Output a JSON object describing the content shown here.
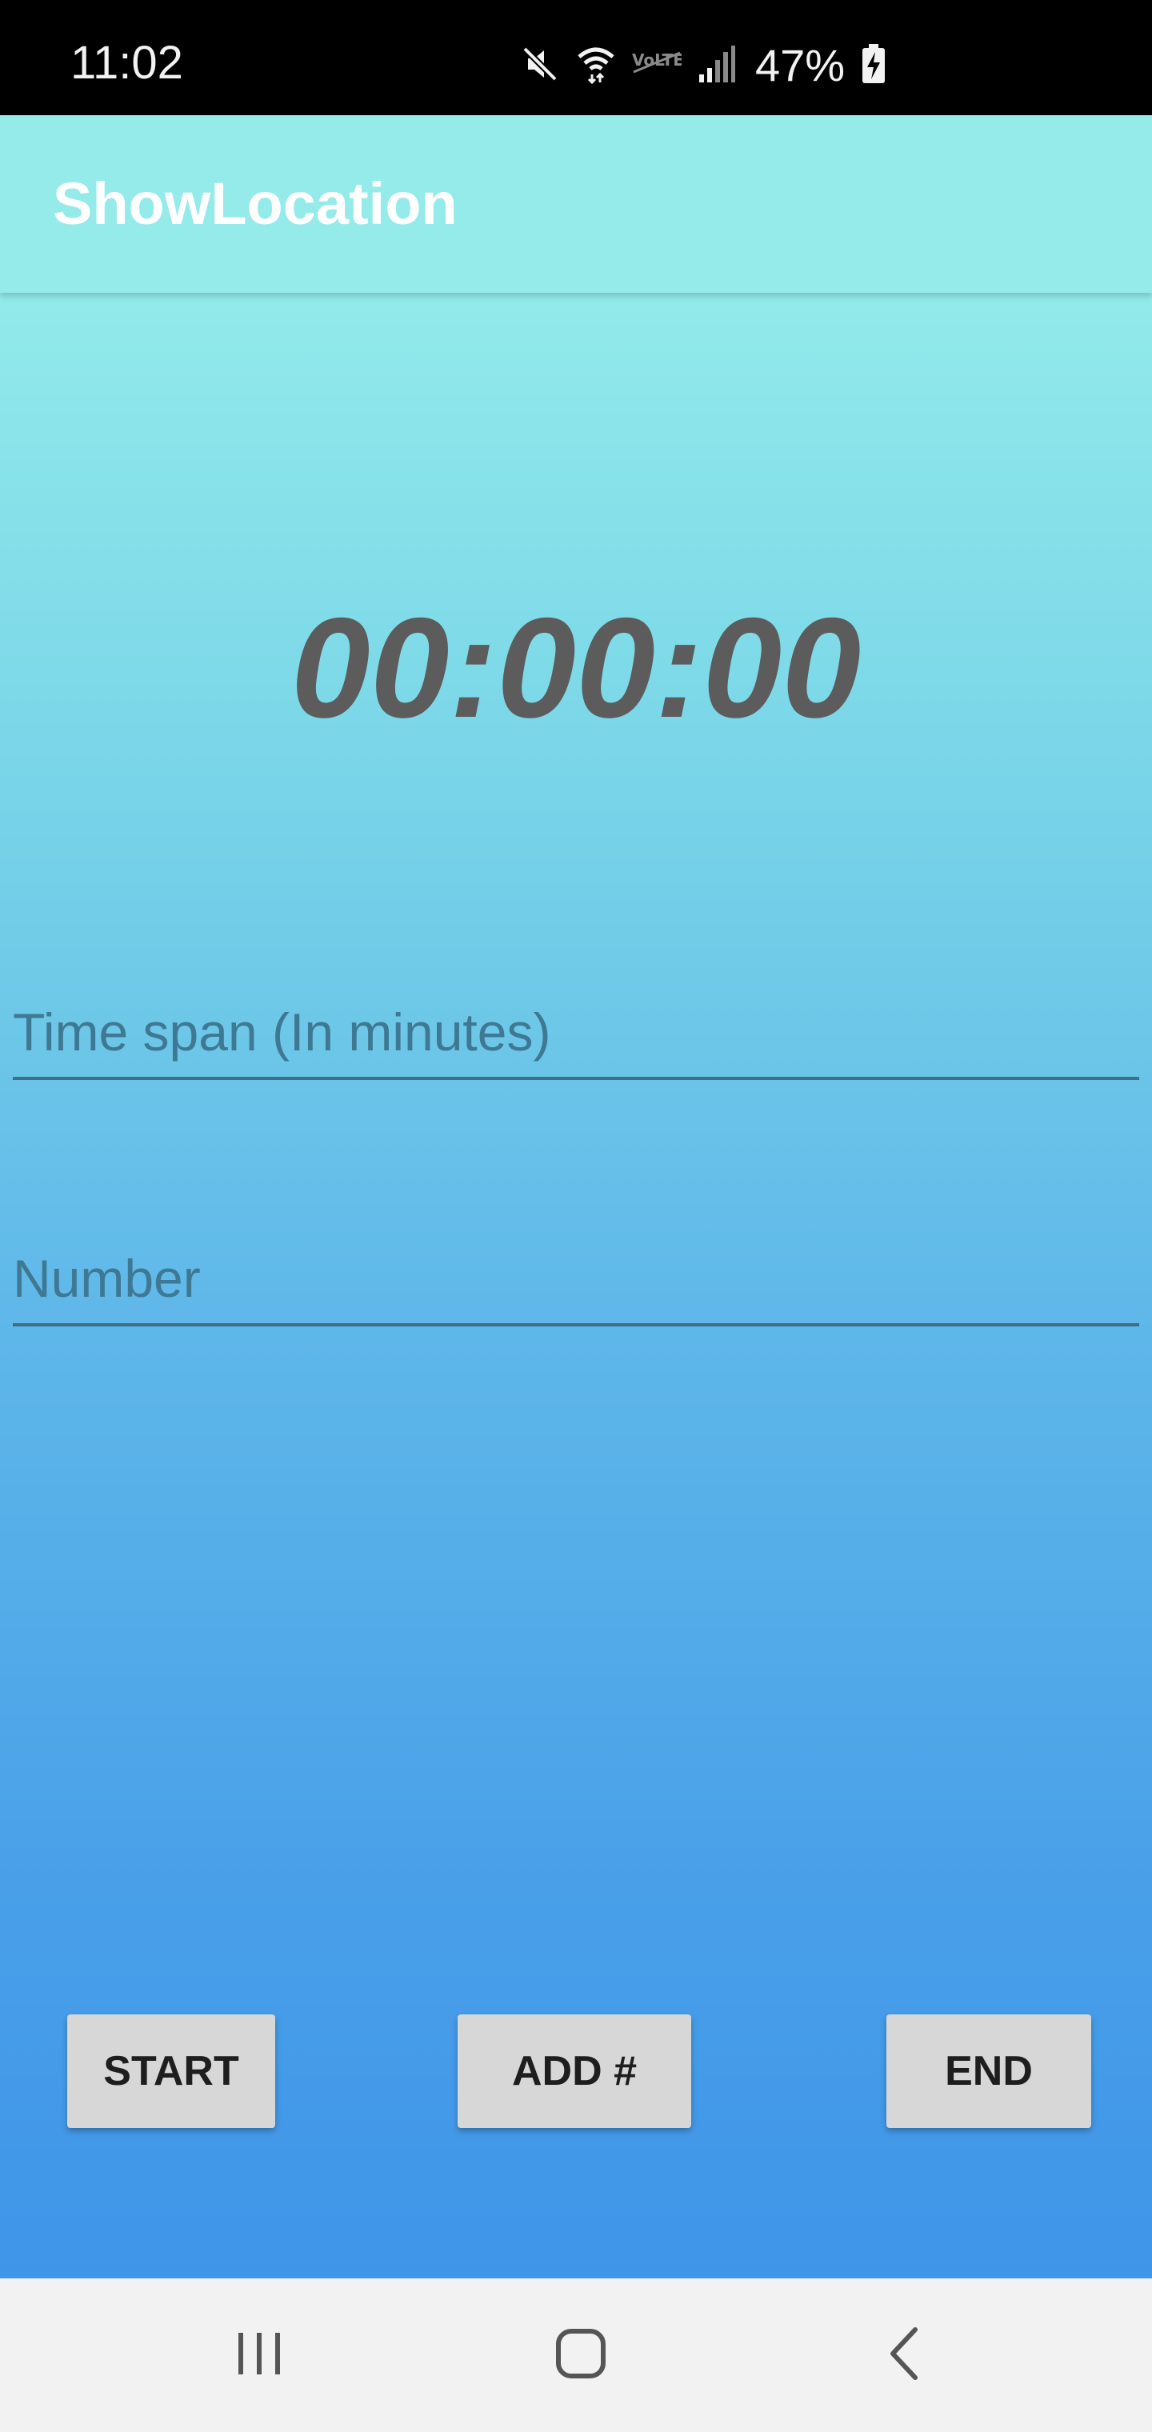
{
  "status_bar": {
    "time": "11:02",
    "battery_percent": "47%",
    "icons": [
      "mute-icon",
      "wifi-icon",
      "volte-icon",
      "signal-icon",
      "battery-charging-icon"
    ]
  },
  "app_bar": {
    "title": "ShowLocation",
    "background_color": "#94ebea"
  },
  "timer": {
    "display": "00:00:00"
  },
  "form": {
    "timespan_placeholder": "Time span (In minutes)",
    "timespan_value": "",
    "number_placeholder": "Number",
    "number_value": ""
  },
  "buttons": {
    "start_label": "START",
    "add_label": "ADD #",
    "end_label": "END"
  },
  "nav_bar": {
    "icons": [
      "recents-icon",
      "home-icon",
      "back-icon"
    ]
  }
}
